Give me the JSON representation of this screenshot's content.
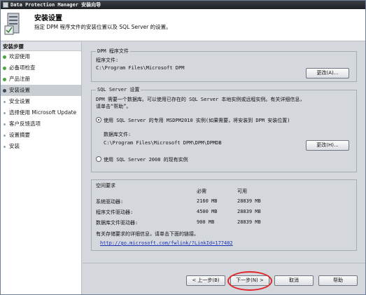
{
  "window": {
    "title": "Data Protection Manager 安装向导"
  },
  "header": {
    "title": "安装设置",
    "subtitle": "指定 DPM 程序文件的安装位置以及 SQL Server 的设置。"
  },
  "sidebar": {
    "heading": "安装步骤",
    "items": [
      {
        "label": "欢迎使用",
        "state": "done"
      },
      {
        "label": "必备项检查",
        "state": "done"
      },
      {
        "label": "产品注册",
        "state": "done"
      },
      {
        "label": "安装设置",
        "state": "active"
      },
      {
        "label": "安全设置",
        "state": "todo"
      },
      {
        "label": "选择使用 Microsoft Update",
        "state": "todo"
      },
      {
        "label": "客户反馈选项",
        "state": "todo"
      },
      {
        "label": "设置摘要",
        "state": "todo"
      },
      {
        "label": "安装",
        "state": "todo"
      }
    ]
  },
  "program_files": {
    "legend": "DPM 程序文件",
    "label": "程序文件:",
    "path": "C:\\Program Files\\Microsoft DPM",
    "change_button": "更改(A)..."
  },
  "sql": {
    "legend": "SQL Server 设置",
    "description_line1": "DPM 需要一个数据库。可以使用已存在的 SQL Server 本地实例或远程实例。有关详细信息，",
    "description_line2": "请单击“帮助”。",
    "option_dedicated": "使用 SQL Server 的专用 MSDPM2010 实例(如果需要，将安装到 DPM 安装位置)",
    "db_files_label": "数据库文件:",
    "db_path": "C:\\Program Files\\Microsoft DPM\\DPM\\DPMDB",
    "change_button": "更改(H)...",
    "option_existing": "使用 SQL Server 2008 的现有实例"
  },
  "space": {
    "heading": "空间要求",
    "col_required": "必需",
    "col_available": "可用",
    "rows": [
      {
        "label": "系统驱动器:",
        "required": "2160 MB",
        "available": "28839 MB"
      },
      {
        "label": "程序文件驱动器:",
        "required": "4500 MB",
        "available": "28839 MB"
      },
      {
        "label": "数据库文件驱动器:",
        "required": "900 MB",
        "available": "28839 MB"
      }
    ],
    "note": "有关存储要求的详细信息，请单击下面的链接。",
    "link": "http://go.microsoft.com/fwlink/?LinkId=177402"
  },
  "footer": {
    "back": "< 上一步(B)",
    "next": "下一步(N) >",
    "cancel": "取消",
    "help": "帮助"
  },
  "colors": {
    "completed_step": "#46a83a",
    "annotation_circle": "#e0262a",
    "link": "#1630b5"
  }
}
